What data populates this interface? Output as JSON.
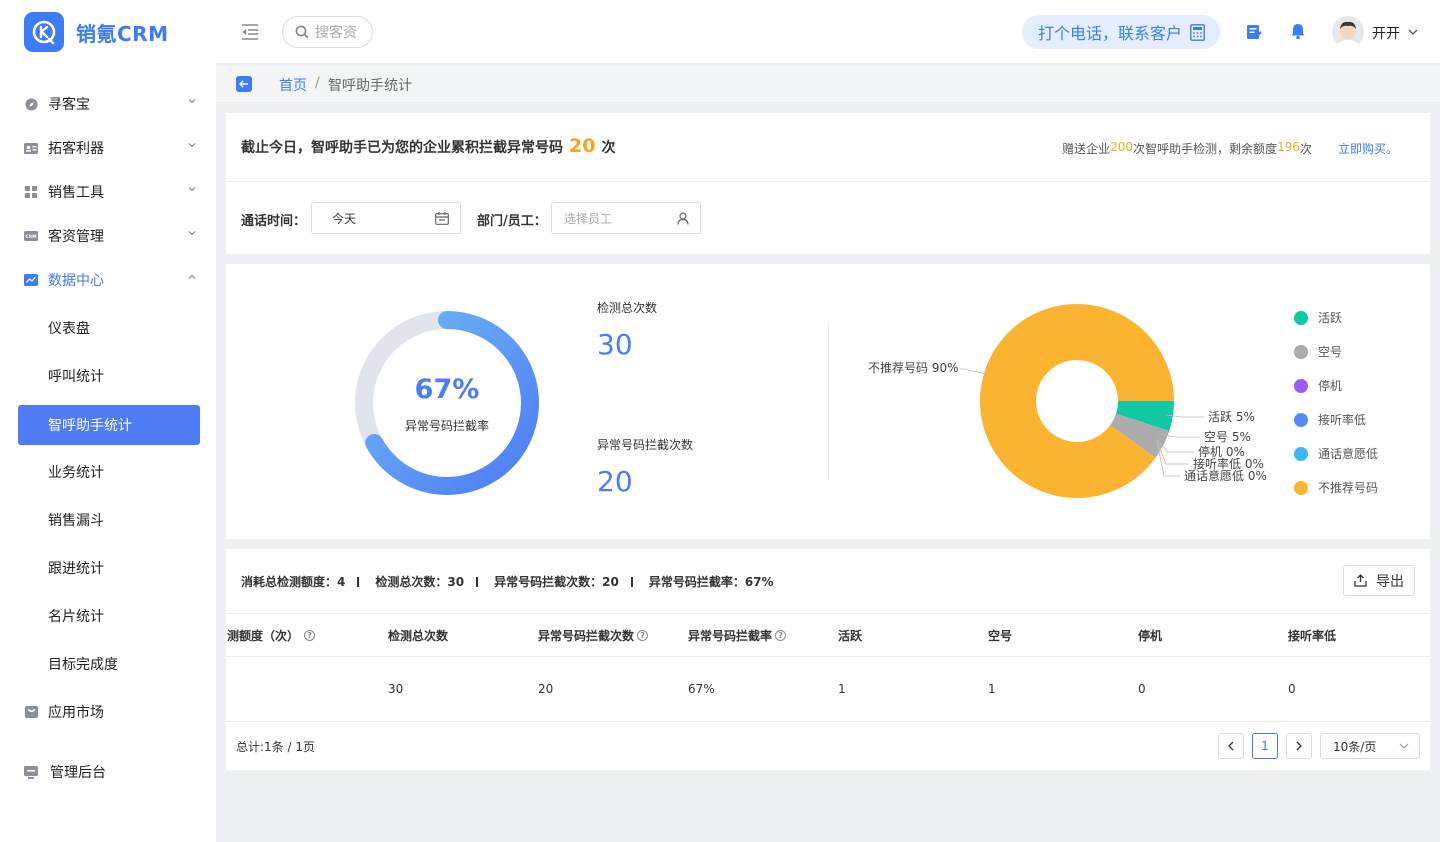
{
  "app": {
    "name": "销氪CRM"
  },
  "sidebar": {
    "items": [
      {
        "label": "寻客宝",
        "icon": "compass-icon"
      },
      {
        "label": "拓客利器",
        "icon": "id-card-icon"
      },
      {
        "label": "销售工具",
        "icon": "grid-icon"
      },
      {
        "label": "客资管理",
        "icon": "crm-icon"
      },
      {
        "label": "数据中心",
        "icon": "chart-icon"
      }
    ],
    "sub_items": [
      "仪表盘",
      "呼叫统计",
      "智呼助手统计",
      "业务统计",
      "销售漏斗",
      "跟进统计",
      "名片统计",
      "目标完成度"
    ],
    "market": "应用市场",
    "admin": "管理后台"
  },
  "topbar": {
    "search_placeholder": "搜客资",
    "call_label": "打个电话，联系客户",
    "user_name": "开开"
  },
  "breadcrumb": {
    "home": "首页",
    "sep": "/",
    "current": "智呼助手统计"
  },
  "summary": {
    "prefix": "截止今日，智呼助手已为您的企业累积拦截异常号码",
    "count": "20",
    "suffix": "次",
    "gift_prefix": "赠送企业",
    "gift_amount": "200",
    "gift_mid": "次智呼助手检测，剩余额度",
    "remaining": "196",
    "gift_suffix": "次",
    "buy_link": "立即购买。"
  },
  "filters": {
    "time_label": "通话时间：",
    "time_value": "今天",
    "dept_label": "部门/员工：",
    "dept_placeholder": "选择员工"
  },
  "stats": {
    "gauge_percent": "67%",
    "gauge_value": 0.67,
    "gauge_label": "异常号码拦截率",
    "total_label": "检测总次数",
    "total_value": "30",
    "blocked_label": "异常号码拦截次数",
    "blocked_value": "20"
  },
  "chart_data": {
    "type": "pie",
    "donut": true,
    "slices": [
      {
        "name": "活跃",
        "value": 5,
        "label": "活跃 5%",
        "color": "#13c9a4"
      },
      {
        "name": "空号",
        "value": 5,
        "label": "空号 5%",
        "color": "#acacac"
      },
      {
        "name": "停机",
        "value": 0,
        "label": "停机 0%",
        "color": "#9b59f5"
      },
      {
        "name": "接听率低",
        "value": 0,
        "label": "接听率低 0%",
        "color": "#5887f7"
      },
      {
        "name": "通话意愿低",
        "value": 0,
        "label": "通话意愿低 0%",
        "color": "#3cb8f0"
      },
      {
        "name": "不推荐号码",
        "value": 90,
        "label": "不推荐号码 90%",
        "color": "#fbb332"
      }
    ],
    "legend_position": "right"
  },
  "table_summary": {
    "consumed_label": "消耗总检测额度：",
    "consumed": "4",
    "total_label": "检测总次数：",
    "total": "30",
    "blocked_label": "异常号码拦截次数：",
    "blocked": "20",
    "rate_label": "异常号码拦截率：",
    "rate": "67%",
    "export_label": "导出"
  },
  "table": {
    "headers": [
      "测额度（次）",
      "检测总次数",
      "异常号码拦截次数",
      "异常号码拦截率",
      "活跃",
      "空号",
      "停机",
      "接听率低"
    ],
    "row": [
      "",
      "30",
      "20",
      "67%",
      "1",
      "1",
      "0",
      "0"
    ]
  },
  "pagination": {
    "total_text": "总计:1条 / 1页",
    "page": "1",
    "page_size": "10条/页"
  },
  "colors": {
    "accent": "#3e7bf6",
    "orange": "#f5a623"
  }
}
